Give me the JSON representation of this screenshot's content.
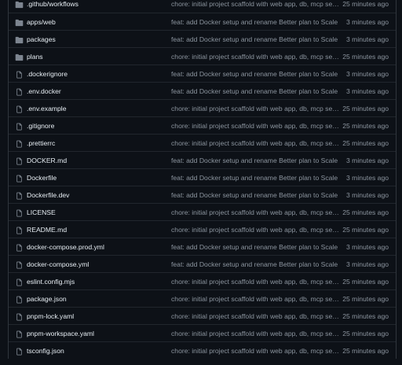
{
  "files": [
    {
      "icon": "folder-icon",
      "name": ".github/workflows",
      "message": "chore: initial project scaffold with web app, db, mcp server",
      "age": "25 minutes ago"
    },
    {
      "icon": "folder-icon",
      "name": "apps/web",
      "message": "feat: add Docker setup and rename Better plan to Scale",
      "age": "3 minutes ago"
    },
    {
      "icon": "folder-icon",
      "name": "packages",
      "message": "feat: add Docker setup and rename Better plan to Scale",
      "age": "3 minutes ago"
    },
    {
      "icon": "folder-icon",
      "name": "plans",
      "message": "chore: initial project scaffold with web app, db, mcp server",
      "age": "25 minutes ago"
    },
    {
      "icon": "file-icon",
      "name": ".dockerignore",
      "message": "feat: add Docker setup and rename Better plan to Scale",
      "age": "3 minutes ago"
    },
    {
      "icon": "file-icon",
      "name": ".env.docker",
      "message": "feat: add Docker setup and rename Better plan to Scale",
      "age": "3 minutes ago"
    },
    {
      "icon": "file-icon",
      "name": ".env.example",
      "message": "chore: initial project scaffold with web app, db, mcp server",
      "age": "25 minutes ago"
    },
    {
      "icon": "file-icon",
      "name": ".gitignore",
      "message": "chore: initial project scaffold with web app, db, mcp server",
      "age": "25 minutes ago"
    },
    {
      "icon": "file-icon",
      "name": ".prettierrc",
      "message": "chore: initial project scaffold with web app, db, mcp server",
      "age": "25 minutes ago"
    },
    {
      "icon": "file-icon",
      "name": "DOCKER.md",
      "message": "feat: add Docker setup and rename Better plan to Scale",
      "age": "3 minutes ago"
    },
    {
      "icon": "file-icon",
      "name": "Dockerfile",
      "message": "feat: add Docker setup and rename Better plan to Scale",
      "age": "3 minutes ago"
    },
    {
      "icon": "file-icon",
      "name": "Dockerfile.dev",
      "message": "feat: add Docker setup and rename Better plan to Scale",
      "age": "3 minutes ago"
    },
    {
      "icon": "file-icon",
      "name": "LICENSE",
      "message": "chore: initial project scaffold with web app, db, mcp server",
      "age": "25 minutes ago"
    },
    {
      "icon": "file-icon",
      "name": "README.md",
      "message": "chore: initial project scaffold with web app, db, mcp server",
      "age": "25 minutes ago"
    },
    {
      "icon": "file-icon",
      "name": "docker-compose.prod.yml",
      "message": "feat: add Docker setup and rename Better plan to Scale",
      "age": "3 minutes ago"
    },
    {
      "icon": "file-icon",
      "name": "docker-compose.yml",
      "message": "feat: add Docker setup and rename Better plan to Scale",
      "age": "3 minutes ago"
    },
    {
      "icon": "file-icon",
      "name": "eslint.config.mjs",
      "message": "chore: initial project scaffold with web app, db, mcp server",
      "age": "25 minutes ago"
    },
    {
      "icon": "file-icon",
      "name": "package.json",
      "message": "chore: initial project scaffold with web app, db, mcp server",
      "age": "25 minutes ago"
    },
    {
      "icon": "file-icon",
      "name": "pnpm-lock.yaml",
      "message": "chore: initial project scaffold with web app, db, mcp server",
      "age": "25 minutes ago"
    },
    {
      "icon": "file-icon",
      "name": "pnpm-workspace.yaml",
      "message": "chore: initial project scaffold with web app, db, mcp server",
      "age": "25 minutes ago"
    },
    {
      "icon": "file-icon",
      "name": "tsconfig.json",
      "message": "chore: initial project scaffold with web app, db, mcp server",
      "age": "25 minutes ago"
    }
  ],
  "colors": {
    "background": "#0d1117",
    "name_text": "#e6edf3",
    "muted_text": "#8b949e",
    "folder_icon": "#7d8590",
    "border": "#21262d"
  }
}
